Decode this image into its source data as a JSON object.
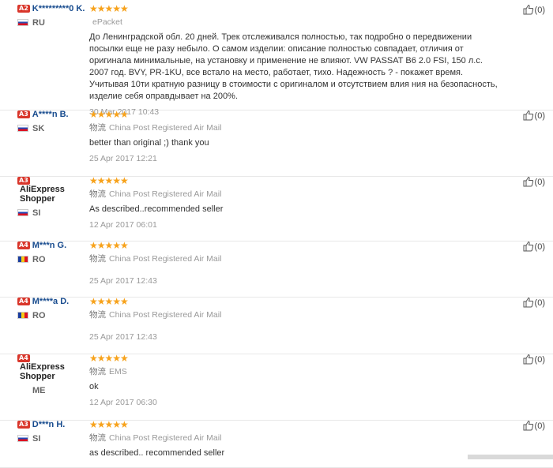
{
  "reviews": [
    {
      "level": "A2",
      "name": "K*********0 K.",
      "country": "RU",
      "flag": "ru",
      "stars": "★★★★★",
      "ship_label": "",
      "ship_method": "ePacket",
      "text": "До Ленинградской обл. 20 дней. Трек отслеживался полностью, так подробно о передвижении посылки еще не разу небыло. О самом изделии: описание полностью совпадает, отличия от оригинала минимальные, на установку и применение не влияют. VW PASSAT B6 2.0 FSI, 150 л.с. 2007 год. BVY, PR-1KU, все встало на место, работает, тихо. Надежность ? - покажет время. Учитывая 10ти кратную разницу в стоимости с оригиналом и отсутствием влия ния на безопасность, изделие себя оправдывает на 200%.",
      "date": "30 Mar 2017 10:43",
      "helpful": "(0)"
    },
    {
      "level": "A3",
      "name": "A****n B.",
      "country": "SK",
      "flag": "sk",
      "stars": "★★★★★",
      "ship_label": "物流",
      "ship_method": "China Post Registered Air Mail",
      "text": "better than original ;) thank you",
      "date": "25 Apr 2017 12:21",
      "helpful": "(0)"
    },
    {
      "level": "A3",
      "name": "AliExpress Shopper",
      "country": "SI",
      "flag": "si",
      "stars": "★★★★★",
      "ship_label": "物流",
      "ship_method": "China Post Registered Air Mail",
      "text": "As described..recommended seller",
      "date": "12 Apr 2017 06:01",
      "helpful": "(0)"
    },
    {
      "level": "A4",
      "name": "M***n G.",
      "country": "RO",
      "flag": "ro",
      "stars": "★★★★★",
      "ship_label": "物流",
      "ship_method": "China Post Registered Air Mail",
      "text": "",
      "date": "25 Apr 2017 12:43",
      "helpful": "(0)"
    },
    {
      "level": "A4",
      "name": "M****a D.",
      "country": "RO",
      "flag": "ro",
      "stars": "★★★★★",
      "ship_label": "物流",
      "ship_method": "China Post Registered Air Mail",
      "text": "",
      "date": "25 Apr 2017 12:43",
      "helpful": "(0)"
    },
    {
      "level": "A4",
      "name": "AliExpress Shopper",
      "country": "ME",
      "flag": "none",
      "stars": "★★★★★",
      "ship_label": "物流",
      "ship_method": "EMS",
      "text": "ok",
      "date": "12 Apr 2017 06:30",
      "helpful": "(0)"
    },
    {
      "level": "A3",
      "name": "D***n H.",
      "country": "SI",
      "flag": "si",
      "stars": "★★★★★",
      "ship_label": "物流",
      "ship_method": "China Post Registered Air Mail",
      "text": "as described.. recommended seller",
      "date": "",
      "helpful": "(0)"
    }
  ],
  "colors": {
    "star": "#f7a21b",
    "level_badge": "#d9362b",
    "username": "#174b8e"
  },
  "icons": {
    "helpful": "thumbs-up-icon",
    "stars": "star-icon"
  }
}
